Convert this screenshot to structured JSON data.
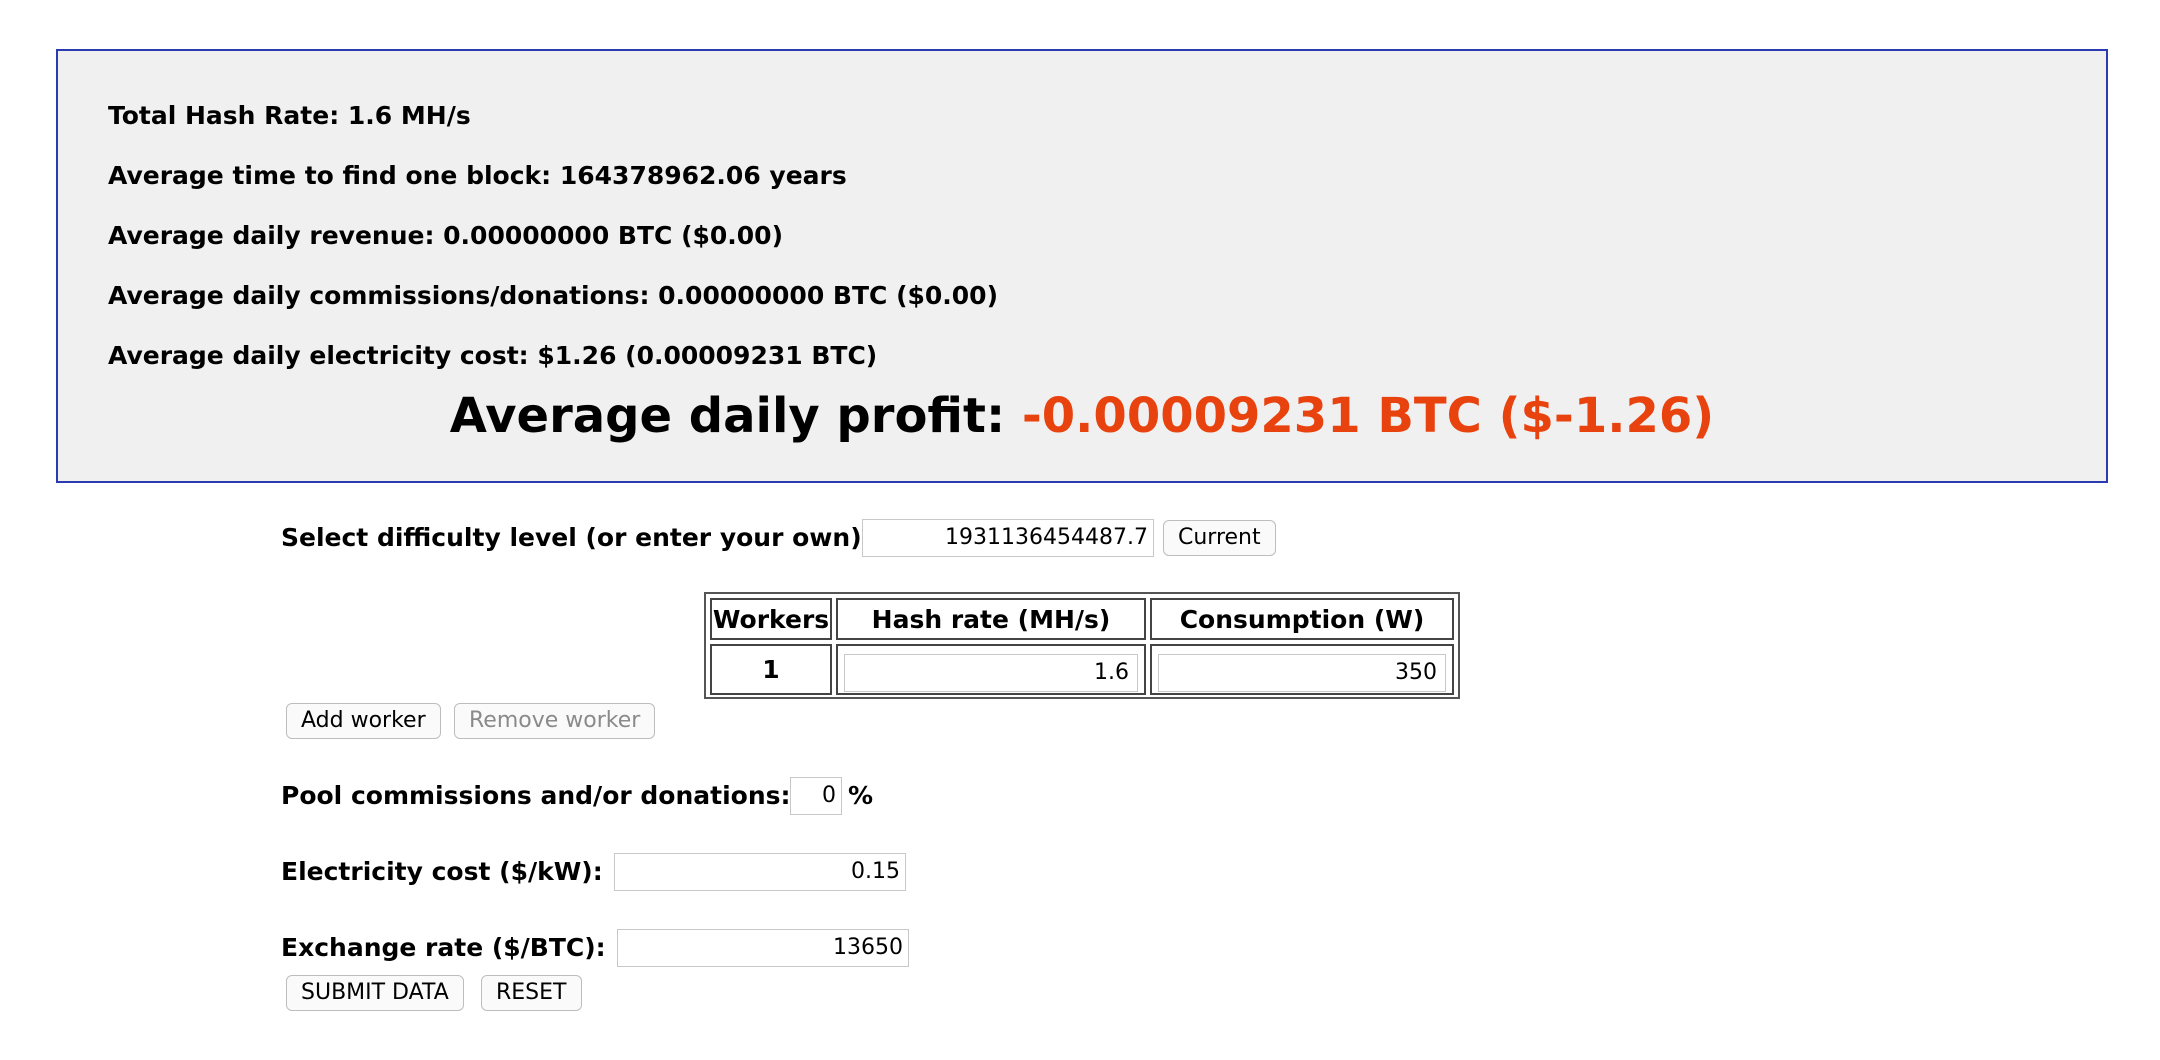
{
  "results": {
    "total_hash_rate": "Total Hash Rate: 1.6 MH/s",
    "avg_time_block": "Average time to find one block: 164378962.06 years",
    "avg_daily_revenue": "Average daily revenue: 0.00000000 BTC ($0.00)",
    "avg_daily_commissions": "Average daily commissions/donations: 0.00000000 BTC ($0.00)",
    "avg_daily_electricity": "Average daily electricity cost: $1.26 (0.00009231 BTC)",
    "profit_label": "Average daily profit: ",
    "profit_value": "-0.00009231 BTC ($-1.26)",
    "profit_color": "#e8420e"
  },
  "difficulty": {
    "label": "Select difficulty level (or enter your own):",
    "value": "1931136454487.7",
    "current_button": "Current"
  },
  "workers_table": {
    "headers": [
      "Workers",
      "Hash rate (MH/s)",
      "Consumption (W)"
    ],
    "rows": [
      {
        "worker": "1",
        "hash_rate": "1.6",
        "consumption": "350"
      }
    ]
  },
  "worker_buttons": {
    "add": "Add worker",
    "remove": "Remove worker"
  },
  "pool": {
    "label": "Pool commissions and/or donations:",
    "value": "0",
    "unit": "%"
  },
  "electricity": {
    "label": "Electricity cost ($/kW):",
    "value": "0.15"
  },
  "exchange": {
    "label": "Exchange rate ($/BTC):",
    "value": "13650"
  },
  "form_buttons": {
    "submit": "SUBMIT DATA",
    "reset": "RESET"
  },
  "colors": {
    "panel_border": "#2b3bb0",
    "panel_background": "#f0f0f0"
  }
}
